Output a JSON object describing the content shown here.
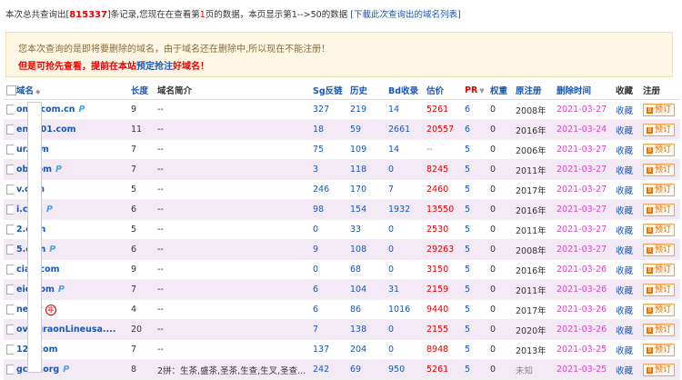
{
  "summary": {
    "prefix": "本次总共查询出[",
    "total": "815337",
    "mid": "]条记录,您现在在查看第",
    "page": "1",
    "mid2": "页的数据，本页显示第1-->50的数据",
    "download_link": "[下載此次查询出的域名列表]"
  },
  "notice": {
    "line1": "您本次查询的是即将要删除的域名，由于域名还在删除中,所以现在不能注册！",
    "line2_a": "但是可抢先查看，提前在本站",
    "line2_b": "预定抢注",
    "line2_c": "好域名！"
  },
  "headers": {
    "domain": "域名",
    "length": "长度",
    "intro": "域名简介",
    "sg": "Sg反链",
    "history": "历史",
    "bd": "Bd收录",
    "price": "估价",
    "pr": "PR",
    "weight": "权重",
    "reg": "原注册",
    "del_time": "删除时间",
    "fav": "收藏",
    "register": "注册"
  },
  "rows": [
    {
      "domain": "ome.com.cn",
      "p": "P",
      "length": "9",
      "intro": "--",
      "sg": "327",
      "history": "219",
      "bd": "14",
      "price": "5261",
      "pr": "6",
      "weight": "0",
      "reg": "2008年",
      "del": "2021-03-27",
      "fav": "收藏",
      "book": "预订"
    },
    {
      "domain": "eng001.com",
      "length": "11",
      "intro": "--",
      "sg": "18",
      "history": "59",
      "bd": "2661",
      "price": "20557",
      "pr": "6",
      "weight": "0",
      "reg": "2016年",
      "del": "2021-03-24",
      "fav": "收藏",
      "book": "预订"
    },
    {
      "domain": "ur.com",
      "length": "7",
      "intro": "--",
      "sg": "75",
      "history": "109",
      "bd": "14",
      "price": "--",
      "pr": "5",
      "weight": "0",
      "reg": "2006年",
      "del": "2021-03-27",
      "fav": "收藏",
      "book": "预订"
    },
    {
      "domain": "ob.com",
      "p": "P",
      "length": "7",
      "intro": "--",
      "sg": "3",
      "history": "118",
      "bd": "0",
      "price": "8245",
      "pr": "5",
      "weight": "0",
      "reg": "2011年",
      "del": "2021-03-27",
      "fav": "收藏",
      "book": "预订"
    },
    {
      "domain": "v.com",
      "length": "5",
      "intro": "--",
      "sg": "246",
      "history": "170",
      "bd": "7",
      "price": "2460",
      "pr": "5",
      "weight": "0",
      "reg": "2017年",
      "del": "2021-03-27",
      "fav": "收藏",
      "book": "预订"
    },
    {
      "domain": "i.com",
      "p": "P",
      "length": "6",
      "intro": "--",
      "sg": "98",
      "history": "154",
      "bd": "1932",
      "price": "13550",
      "pr": "5",
      "weight": "0",
      "reg": "2016年",
      "del": "2021-03-27",
      "fav": "收藏",
      "book": "预订"
    },
    {
      "domain": "2.com",
      "length": "5",
      "intro": "--",
      "sg": "0",
      "history": "33",
      "bd": "0",
      "price": "2530",
      "pr": "5",
      "weight": "0",
      "reg": "2011年",
      "del": "2021-03-27",
      "fav": "收藏",
      "book": "预订"
    },
    {
      "domain": "5.com",
      "p": "P",
      "length": "6",
      "intro": "--",
      "sg": "9",
      "history": "108",
      "bd": "0",
      "price": "29263",
      "pr": "5",
      "weight": "0",
      "reg": "2008年",
      "del": "2021-03-27",
      "fav": "收藏",
      "book": "预订"
    },
    {
      "domain": "ciao.com",
      "length": "9",
      "intro": "--",
      "sg": "0",
      "history": "68",
      "bd": "0",
      "price": "3150",
      "pr": "5",
      "weight": "0",
      "reg": "2016年",
      "del": "2021-03-26",
      "fav": "收藏",
      "book": "预订"
    },
    {
      "domain": "eio.com",
      "p": "P",
      "length": "7",
      "intro": "--",
      "sg": "6",
      "history": "104",
      "bd": "31",
      "price": "2159",
      "pr": "5",
      "weight": "0",
      "reg": "2011年",
      "del": "2021-03-26",
      "fav": "收藏",
      "book": "预订"
    },
    {
      "domain": "net",
      "p": "P",
      "c": "非",
      "length": "4",
      "intro": "--",
      "sg": "6",
      "history": "86",
      "bd": "1016",
      "price": "9440",
      "pr": "5",
      "weight": "0",
      "reg": "2017年",
      "del": "2021-03-26",
      "fav": "收藏",
      "book": "预订"
    },
    {
      "domain": "oviagraonLineusa....",
      "length": "20",
      "intro": "--",
      "sg": "7",
      "history": "138",
      "bd": "0",
      "price": "2155",
      "pr": "5",
      "weight": "0",
      "reg": "2020年",
      "del": "2021-03-26",
      "fav": "收藏",
      "book": "预订"
    },
    {
      "domain": "123.com",
      "length": "7",
      "intro": "--",
      "sg": "137",
      "history": "204",
      "bd": "0",
      "price": "8948",
      "pr": "5",
      "weight": "0",
      "reg": "2013年",
      "del": "2021-03-25",
      "fav": "收藏",
      "book": "预订"
    },
    {
      "domain": "gcha.org",
      "p": "P",
      "length": "8",
      "intro": "2拼：生茶,盛茶,圣茶,生查,生叉,圣查...",
      "sg": "242",
      "history": "69",
      "bd": "950",
      "price": "5261",
      "pr": "5",
      "weight": "0",
      "reg": "未知",
      "del": "2021-03-25",
      "fav": "收藏",
      "book": "预订"
    }
  ]
}
